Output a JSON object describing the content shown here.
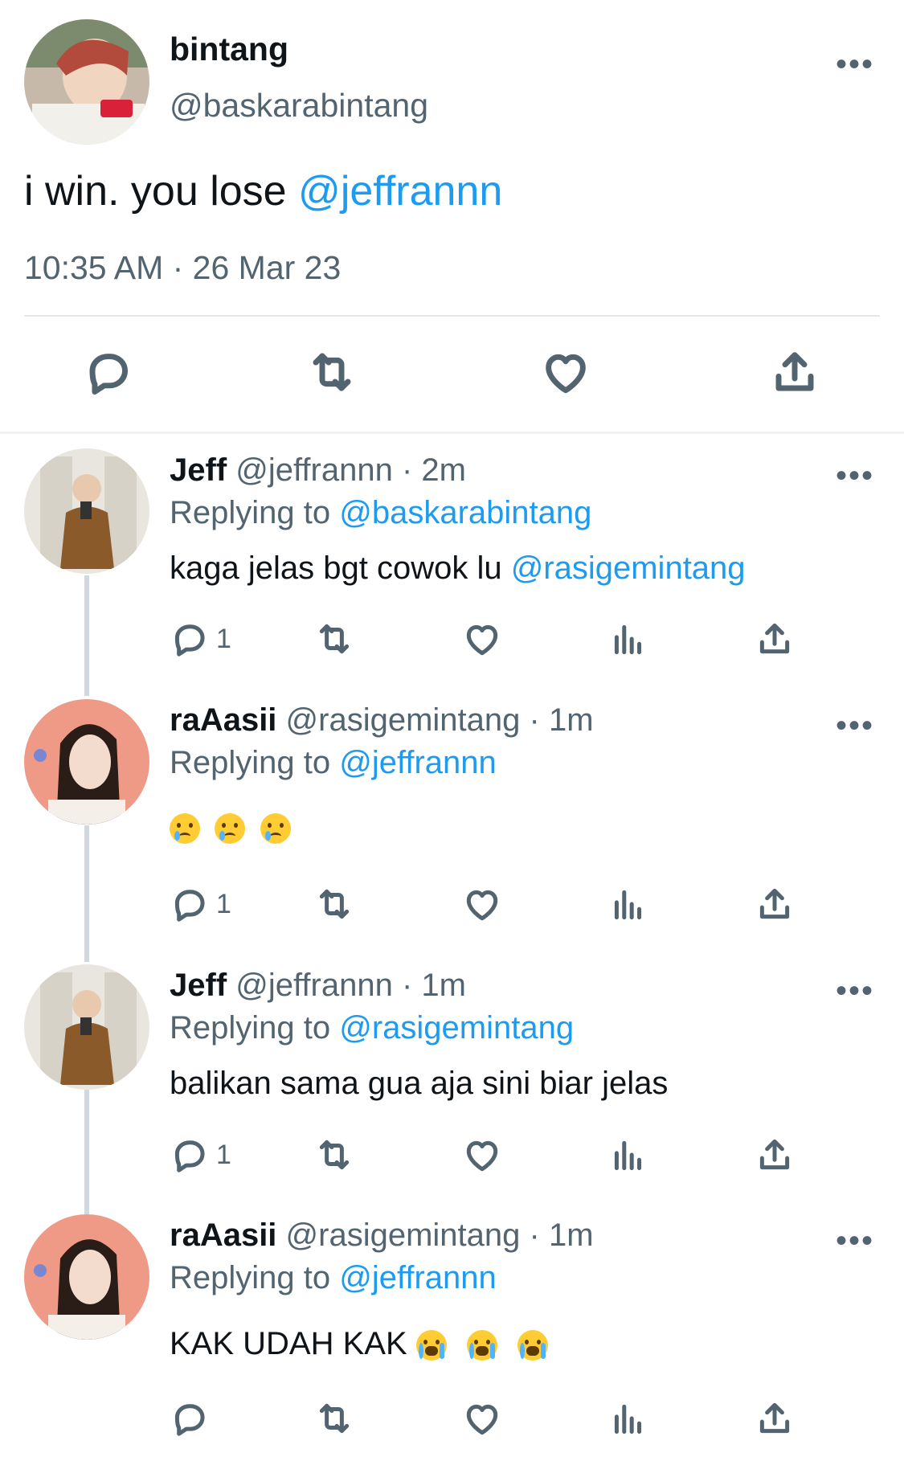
{
  "main_tweet": {
    "name": "bintang",
    "handle": "@baskarabintang",
    "text": "i win. you lose ",
    "mention": "@jeffrannn",
    "timestamp": "10:35 AM · 26 Mar 23",
    "more": "•••",
    "actions": [
      "reply-icon",
      "retweet-icon",
      "like-icon",
      "share-icon"
    ]
  },
  "replies": [
    {
      "name": "Jeff",
      "handle": "@jeffrannn",
      "age": "· 2m",
      "replying_label": "Replying to ",
      "replying_to": "@baskarabintang",
      "text": "kaga jelas bgt cowok lu ",
      "mention": "@rasigemintang",
      "reply_count": "1",
      "more": "•••"
    },
    {
      "name": "raAasii",
      "handle": "@rasigemintang",
      "age": "· 1m",
      "replying_label": "Replying to ",
      "replying_to": "@jeffrannn",
      "text": "",
      "emoji": "🥲🥲🥲",
      "reply_count": "1",
      "more": "•••"
    },
    {
      "name": "Jeff",
      "handle": "@jeffrannn",
      "age": "· 1m",
      "replying_label": "Replying to ",
      "replying_to": "@rasigemintang",
      "text": "balikan sama gua aja sini biar jelas",
      "reply_count": "1",
      "more": "•••"
    },
    {
      "name": "raAasii",
      "handle": "@rasigemintang",
      "age": "· 1m",
      "replying_label": "Replying to ",
      "replying_to": "@jeffrannn",
      "text": "KAK UDAH KAK",
      "emoji": "😭😭😭",
      "reply_count": "",
      "more": "•••"
    }
  ],
  "colors": {
    "link": "#1d9bf0",
    "muted": "#536471",
    "text": "#0f1419",
    "thread_line": "#cfd9de"
  }
}
